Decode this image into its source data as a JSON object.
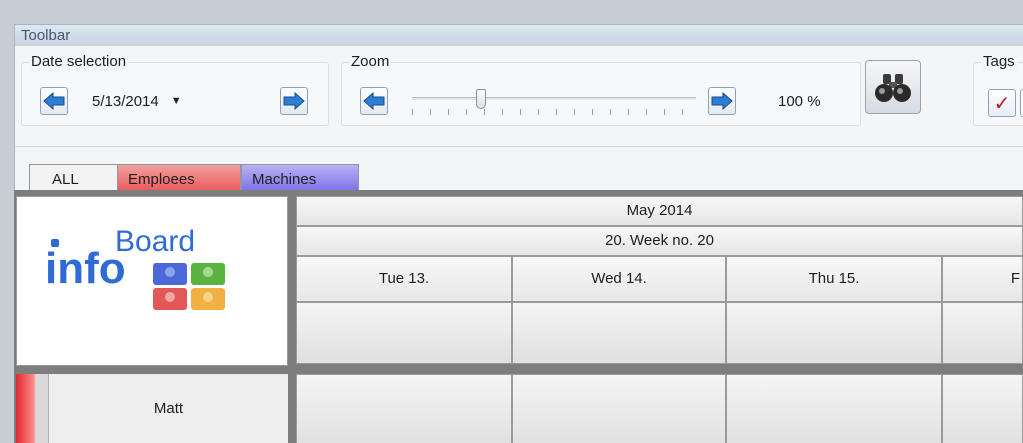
{
  "toolbar": {
    "title": "Toolbar",
    "date_group": {
      "title": "Date selection",
      "value": "5/13/2014"
    },
    "zoom_group": {
      "title": "Zoom",
      "value": "100 %",
      "level_percent": 100
    },
    "tags_group": {
      "title": "Tags"
    }
  },
  "tabs": [
    {
      "label": "ALL",
      "color": "#f3f3f3"
    },
    {
      "label": "Emploees",
      "color": "#ea5c5c"
    },
    {
      "label": "Machines",
      "color": "#7f74e8"
    }
  ],
  "logo": {
    "top": "Board",
    "bottom": "info"
  },
  "calendar": {
    "month": "May 2014",
    "week": "20. Week no. 20",
    "days": [
      "Tue 13.",
      "Wed 14.",
      "Thu 15.",
      "F"
    ]
  },
  "resources": [
    {
      "name": "Matt",
      "color": "#e0282d"
    }
  ],
  "icons": {
    "prev": "left-arrow-icon",
    "next": "right-arrow-icon",
    "search": "binoculars-icon",
    "tag_check": "checkmark-icon"
  }
}
